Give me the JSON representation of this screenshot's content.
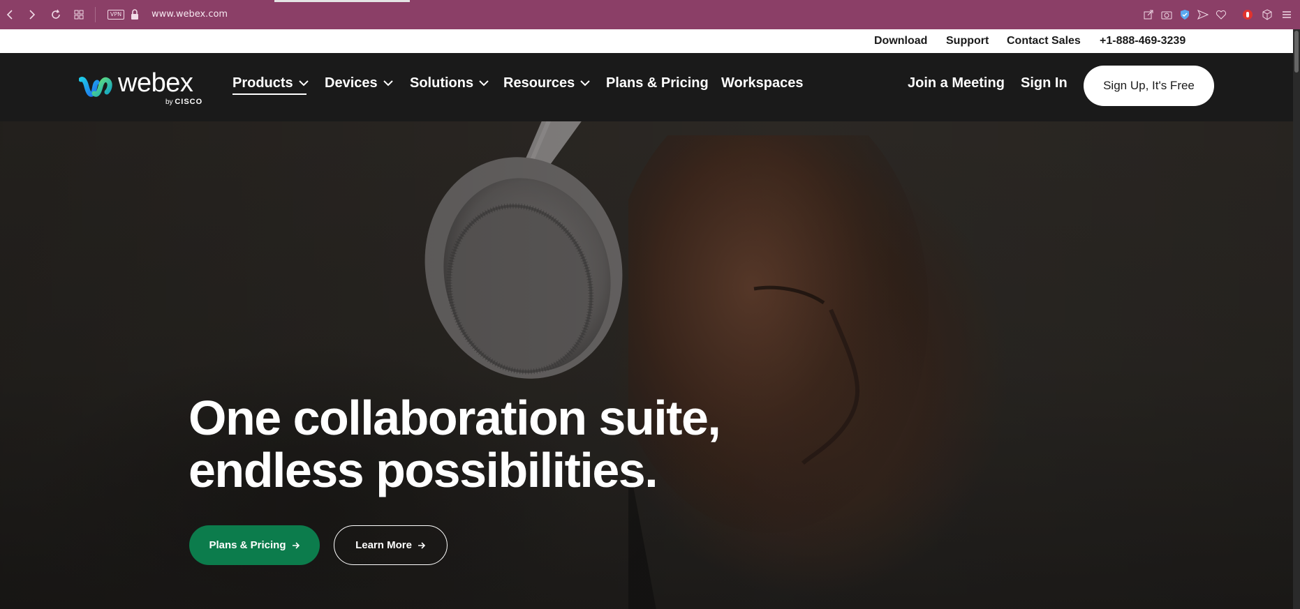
{
  "browser": {
    "url": "www.webex.com",
    "vpn_label": "VPN"
  },
  "utility": {
    "download": "Download",
    "support": "Support",
    "contact_sales": "Contact Sales",
    "phone": "+1-888-469-3239"
  },
  "logo": {
    "word": "webex",
    "by": "by",
    "brand": "CISCO"
  },
  "nav": {
    "products": "Products",
    "devices": "Devices",
    "solutions": "Solutions",
    "resources": "Resources",
    "plans": "Plans & Pricing",
    "workspaces": "Workspaces",
    "join": "Join a Meeting",
    "sign_in": "Sign In",
    "signup": "Sign Up, It's Free"
  },
  "hero": {
    "title_line1": "One collaboration suite,",
    "title_line2": "endless possibilities.",
    "primary_cta": "Plans & Pricing",
    "secondary_cta": "Learn More"
  },
  "colors": {
    "browser_bar": "#8b3f67",
    "nav_bg": "#1a1a1a",
    "primary_cta": "#0c7c4c"
  }
}
